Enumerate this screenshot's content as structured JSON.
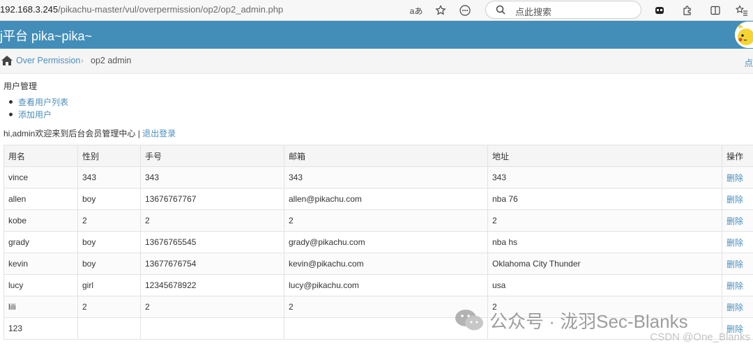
{
  "browser": {
    "url_host": "192.168.3.245",
    "url_path": "/pikachu-master/vul/overpermission/op2/op2_admin.php",
    "search_placeholder": "点此搜索"
  },
  "header": {
    "title": "j平台 pika~pika~"
  },
  "breadcrumb": {
    "link": "Over Permission",
    "separator": "›",
    "current": "op2 admin",
    "right_text": "点"
  },
  "content": {
    "section_title": "用户管理",
    "menu": [
      "查看用户列表",
      "添加用户"
    ],
    "welcome_text": "hi,admin欢迎来到后台会员管理中心 | ",
    "logout_label": "退出登录"
  },
  "table": {
    "headers": [
      "用名",
      "性别",
      "手号",
      "邮箱",
      "地址",
      "操作"
    ],
    "action_label": "删除",
    "rows": [
      [
        "vince",
        "343",
        "343",
        "343",
        "343"
      ],
      [
        "allen",
        "boy",
        "13676767767",
        "allen@pikachu.com",
        "nba 76"
      ],
      [
        "kobe",
        "2",
        "2",
        "2",
        "2"
      ],
      [
        "grady",
        "boy",
        "13676765545",
        "grady@pikachu.com",
        "nba hs"
      ],
      [
        "kevin",
        "boy",
        "13677676754",
        "kevin@pikachu.com",
        "Oklahoma City Thunder"
      ],
      [
        "lucy",
        "girl",
        "12345678922",
        "lucy@pikachu.com",
        "usa"
      ],
      [
        "lili",
        "2",
        "2",
        "2",
        "2"
      ],
      [
        "123",
        "",
        "",
        "",
        ""
      ]
    ]
  },
  "watermark": {
    "main": "公众号 · 泷羽Sec-Blanks",
    "secondary": "CSDN @One_Blanks"
  },
  "colors": {
    "header_bg": "#438eb9",
    "link": "#4c8fbd"
  }
}
